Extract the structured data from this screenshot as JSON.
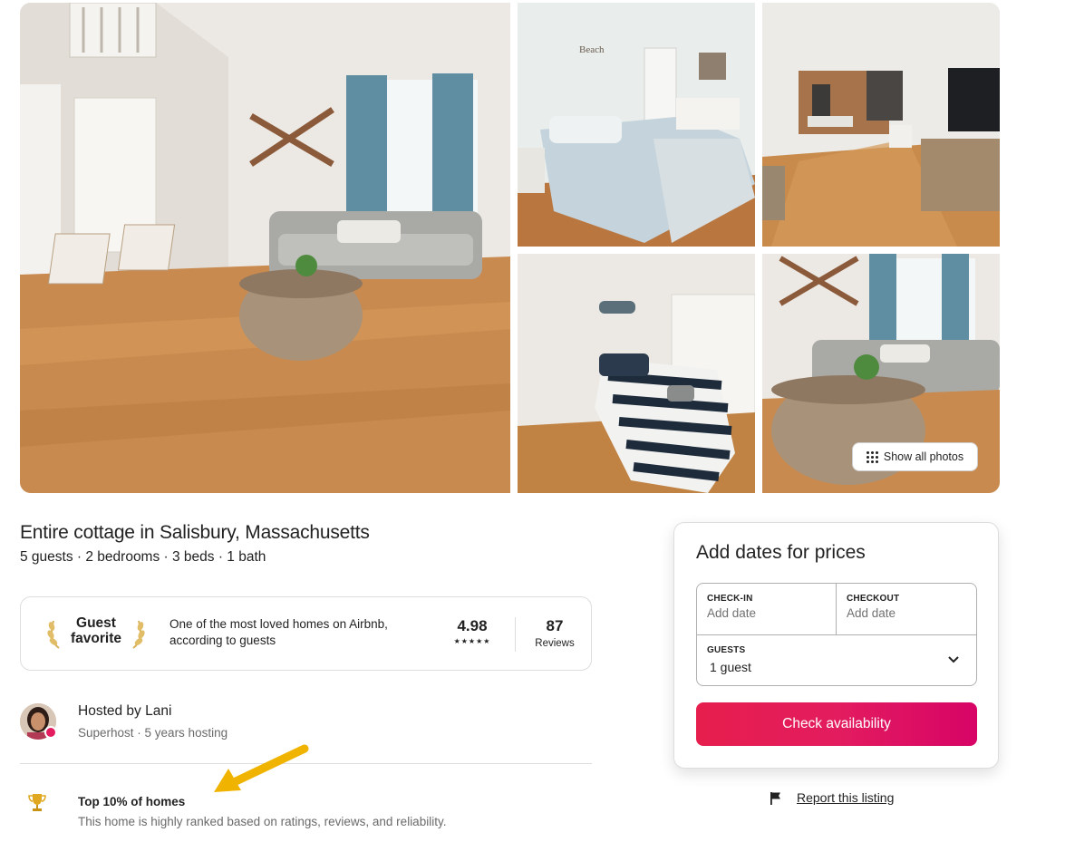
{
  "gallery": {
    "show_all_label": "Show all photos",
    "photos": [
      {
        "name": "living-room",
        "scene": "living room"
      },
      {
        "name": "bedroom-beach",
        "scene": "bedroom"
      },
      {
        "name": "kitchen-hall",
        "scene": "kitchen"
      },
      {
        "name": "bedroom-striped",
        "scene": "bedroom"
      },
      {
        "name": "living-room-2",
        "scene": "living room"
      }
    ],
    "decor_sign": "Beach"
  },
  "listing": {
    "title": "Entire cottage in Salisbury, Massachusetts",
    "details": "5 guests · 2 bedrooms · 3 beds · 1 bath"
  },
  "guest_favorite": {
    "label": "Guest favorite",
    "description": "One of the most loved homes on Airbnb, according to guests",
    "rating": "4.98",
    "stars": "★★★★★",
    "reviews_count": "87",
    "reviews_label": "Reviews"
  },
  "host": {
    "title": "Hosted by Lani",
    "meta": "Superhost · 5 years hosting"
  },
  "highlight": {
    "title": "Top 10% of homes",
    "description": "This home is highly ranked based on ratings, reviews, and reliability.",
    "icon": "trophy-icon"
  },
  "booking": {
    "title": "Add dates for prices",
    "checkin_label": "CHECK-IN",
    "checkin_value": "Add date",
    "checkout_label": "CHECKOUT",
    "checkout_value": "Add date",
    "guests_label": "GUESTS",
    "guests_value": "1 guest",
    "button_label": "Check availability",
    "button_color": "#e31c5f"
  },
  "report": {
    "label": "Report this listing",
    "icon": "flag-icon"
  },
  "annotation": {
    "arrow_color": "#f0b400"
  }
}
